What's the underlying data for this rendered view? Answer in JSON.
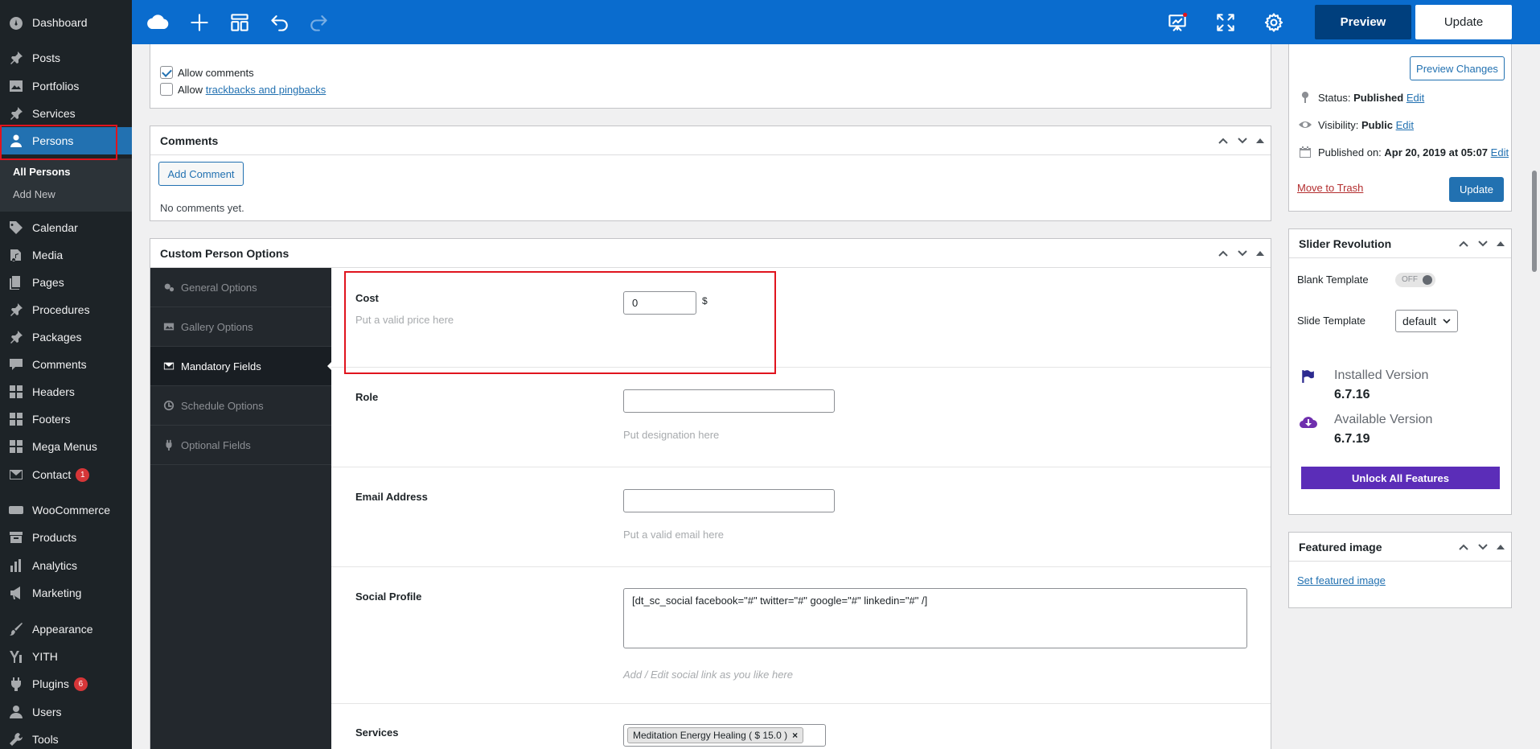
{
  "sidebar": {
    "items": [
      {
        "label": "Dashboard",
        "icon": "dashboard-icon"
      },
      {
        "label": "Posts",
        "icon": "pin-icon"
      },
      {
        "label": "Portfolios",
        "icon": "image-icon"
      },
      {
        "label": "Services",
        "icon": "pin-icon"
      },
      {
        "label": "Persons",
        "icon": "person-icon"
      },
      {
        "label": "Calendar",
        "icon": "tag-icon"
      },
      {
        "label": "Media",
        "icon": "media-icon"
      },
      {
        "label": "Pages",
        "icon": "page-icon"
      },
      {
        "label": "Procedures",
        "icon": "pin-icon"
      },
      {
        "label": "Packages",
        "icon": "pin-icon"
      },
      {
        "label": "Comments",
        "icon": "comment-icon"
      },
      {
        "label": "Headers",
        "icon": "grid-icon"
      },
      {
        "label": "Footers",
        "icon": "grid-icon"
      },
      {
        "label": "Mega Menus",
        "icon": "grid-icon"
      },
      {
        "label": "Contact",
        "icon": "mail-icon",
        "badge": "1"
      },
      {
        "label": "WooCommerce",
        "icon": "woo-icon"
      },
      {
        "label": "Products",
        "icon": "archive-icon"
      },
      {
        "label": "Analytics",
        "icon": "chart-icon"
      },
      {
        "label": "Marketing",
        "icon": "megaphone-icon"
      },
      {
        "label": "Appearance",
        "icon": "brush-icon"
      },
      {
        "label": "YITH",
        "icon": "yith-icon"
      },
      {
        "label": "Plugins",
        "icon": "plug-icon",
        "badge": "6"
      },
      {
        "label": "Users",
        "icon": "user-icon"
      },
      {
        "label": "Tools",
        "icon": "wrench-icon"
      }
    ],
    "submenu": {
      "all": "All Persons",
      "add": "Add New"
    }
  },
  "topbar": {
    "preview": "Preview",
    "update": "Update"
  },
  "discussion": {
    "allow_comments": "Allow comments",
    "allow_prefix": "Allow",
    "trackbacks_link": "trackbacks and pingbacks"
  },
  "comments_panel": {
    "title": "Comments",
    "add_button": "Add Comment",
    "empty": "No comments yet."
  },
  "custom_options": {
    "title": "Custom Person Options",
    "tabs": [
      "General Options",
      "Gallery Options",
      "Mandatory Fields",
      "Schedule Options",
      "Optional Fields"
    ],
    "cost": {
      "label": "Cost",
      "value": "0",
      "unit": "$",
      "desc": "Put a valid price here"
    },
    "role": {
      "label": "Role",
      "value": "",
      "desc": "Put designation here"
    },
    "email": {
      "label": "Email Address",
      "value": "",
      "desc": "Put a valid email here"
    },
    "social": {
      "label": "Social Profile",
      "value": "[dt_sc_social facebook=\"#\" twitter=\"#\" google=\"#\" linkedin=\"#\" /]",
      "desc": "Add / Edit social link as you like here"
    },
    "services": {
      "label": "Services",
      "tag": "Meditation Energy Healing ( $ 15.0 )",
      "tag_remove": "×"
    }
  },
  "publish": {
    "preview_changes": "Preview Changes",
    "status_label": "Status:",
    "status_value": "Published",
    "edit": "Edit",
    "visibility_label": "Visibility:",
    "visibility_value": "Public",
    "published_label": "Published on:",
    "published_value": "Apr 20, 2019 at 05:07",
    "trash": "Move to Trash",
    "update": "Update"
  },
  "slider": {
    "title": "Slider Revolution",
    "blank_label": "Blank Template",
    "toggle": "OFF",
    "slide_label": "Slide Template",
    "slide_value": "default",
    "installed_label": "Installed Version",
    "installed_value": "6.7.16",
    "available_label": "Available Version",
    "available_value": "6.7.19",
    "unlock": "Unlock All Features",
    "accent": "#5b2db8"
  },
  "featured": {
    "title": "Featured image",
    "link": "Set featured image"
  },
  "colors": {
    "sidebar": "#1d2327",
    "active": "#2271b1",
    "topbar": "#0a6cce",
    "highlight": "#e0141e"
  }
}
